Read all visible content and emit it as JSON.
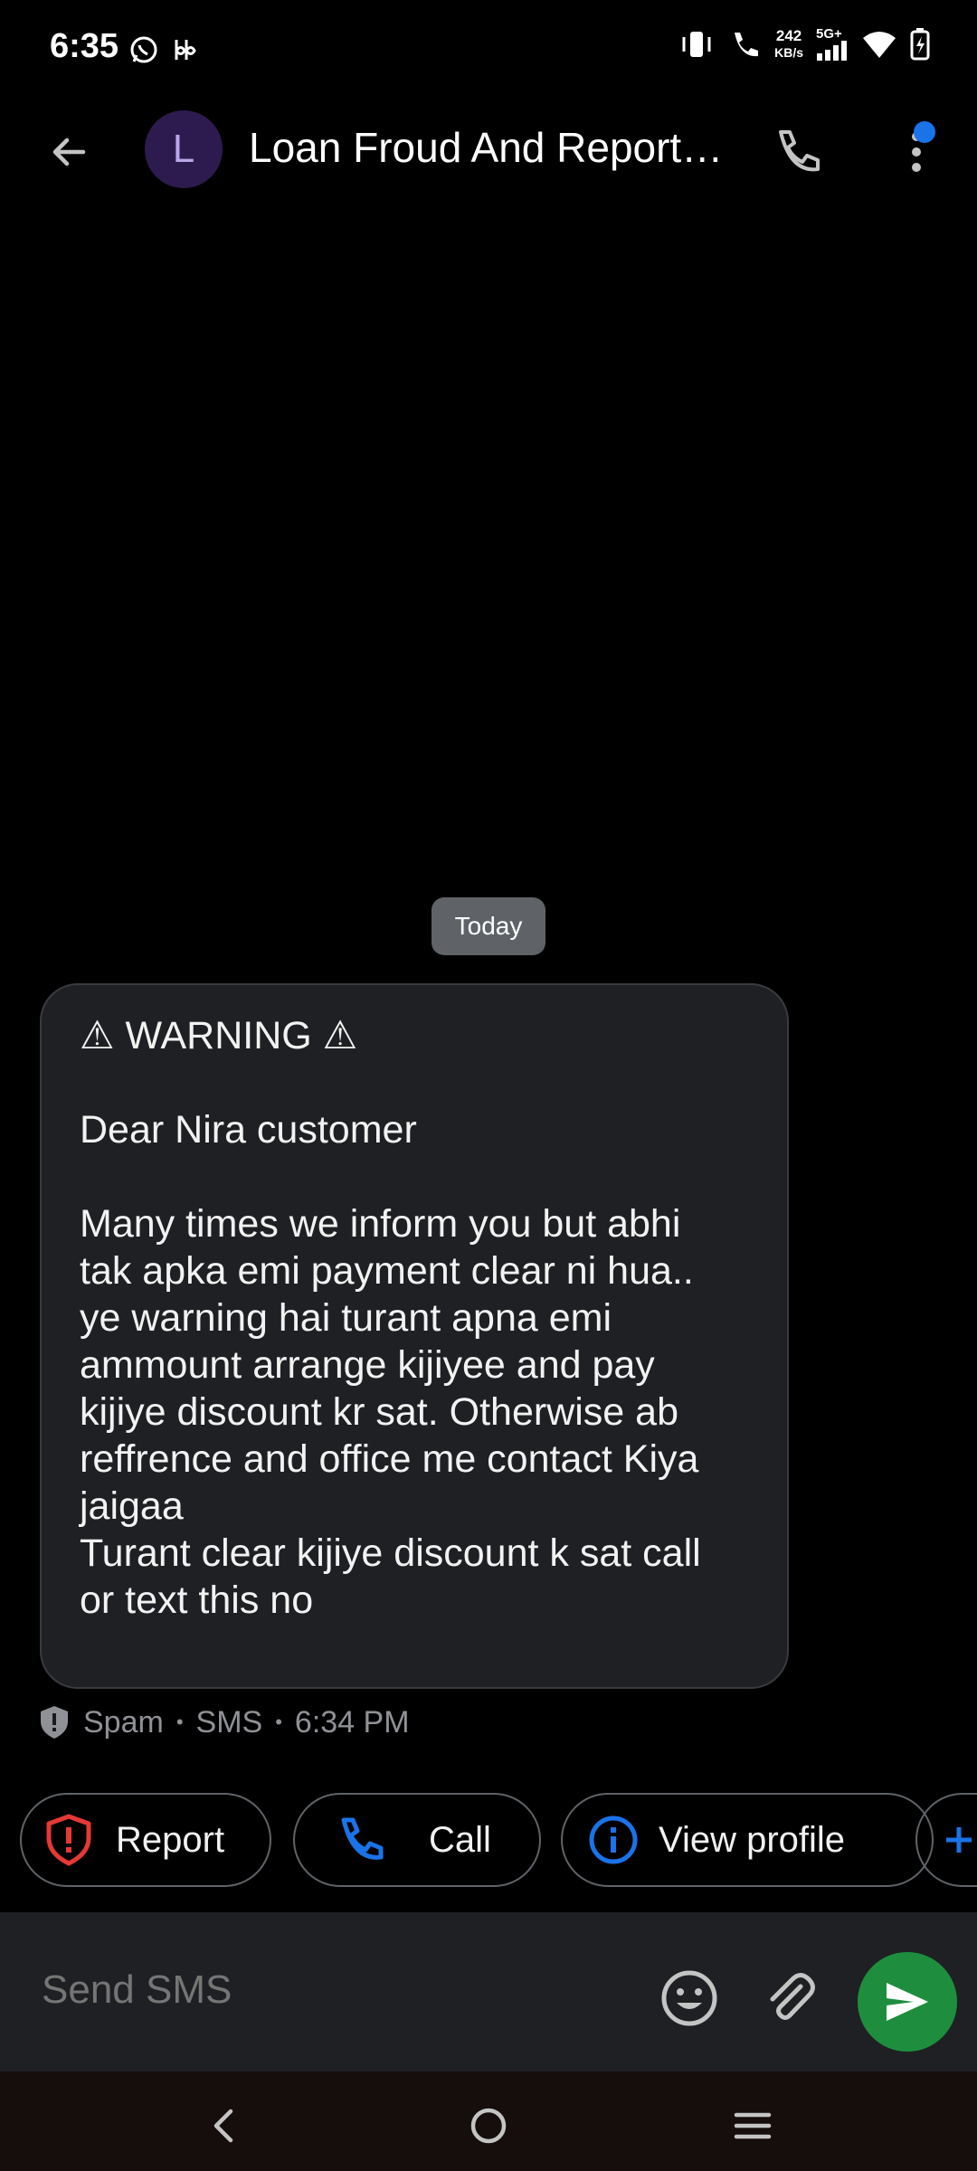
{
  "status_bar": {
    "time": "6:35",
    "net_speed_value": "242",
    "net_speed_unit": "KB/s",
    "network_type": "5G+"
  },
  "header": {
    "avatar_letter": "L",
    "title": "Loan Froud And Report…"
  },
  "conversation": {
    "date_label": "Today",
    "message": {
      "line_warning": "⚠ WARNING ⚠",
      "line_greeting": "Dear Nira customer",
      "body_lines": [
        "Many times we inform you but abhi",
        "tak apka emi payment clear ni hua..",
        "ye warning hai turant apna emi",
        "ammount arrange kijiyee and pay",
        "kijiye discount kr sat. Otherwise ab",
        "reffrence and office me contact Kiya",
        "jaigaa",
        "Turant clear kijiye discount k sat call",
        "or text this no"
      ]
    },
    "meta": {
      "label": "Spam",
      "channel": "SMS",
      "time": "6:34 PM",
      "separator": "•"
    }
  },
  "suggestions": [
    {
      "label": "Report",
      "icon": "shield-alert-icon"
    },
    {
      "label": "Call",
      "icon": "phone-icon"
    },
    {
      "label": "View profile",
      "icon": "info-icon"
    }
  ],
  "compose": {
    "placeholder": "Send SMS"
  },
  "colors": {
    "accent_blue": "#1a73e8",
    "send_green": "#1e8e3e",
    "report_red": "#e53935",
    "bubble_bg": "#1f2023"
  }
}
